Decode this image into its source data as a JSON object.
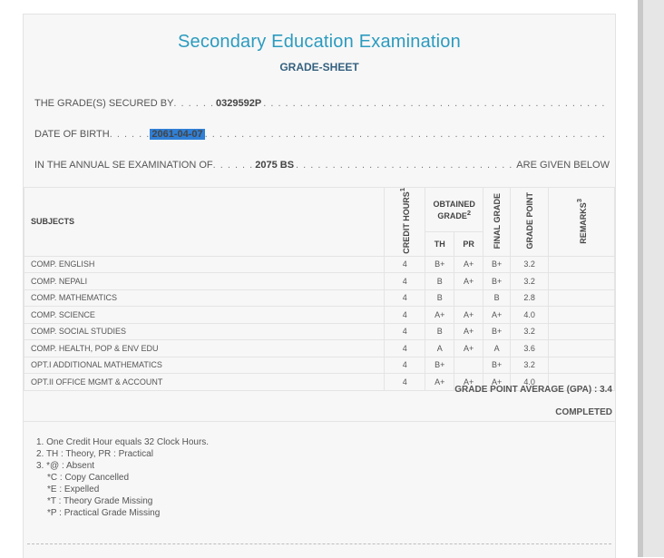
{
  "title": "Secondary Education Examination",
  "subtitle": "GRADE-SHEET",
  "secured_by": {
    "label": "THE GRADE(S) SECURED BY",
    "value": "0329592P"
  },
  "dob": {
    "label": "DATE OF BIRTH",
    "value": "2061-04-07"
  },
  "exam": {
    "label": "IN THE ANNUAL SE EXAMINATION OF",
    "value": "2075 BS",
    "suffix": "ARE GIVEN BELOW"
  },
  "table": {
    "headers": {
      "subjects": "SUBJECTS",
      "credit_hours": "CREDIT HOURS",
      "credit_sup": "1",
      "obtained_grade": "OBTAINED GRADE",
      "obtained_sup": "2",
      "th": "TH",
      "pr": "PR",
      "final_grade": "FINAL GRADE",
      "grade_point": "GRADE POINT",
      "remarks": "REMARKS",
      "remarks_sup": "3"
    },
    "rows": [
      {
        "subject": "COMP. ENGLISH",
        "credit": "4",
        "th": "B+",
        "pr": "A+",
        "final": "B+",
        "gp": "3.2",
        "remarks": ""
      },
      {
        "subject": "COMP. NEPALI",
        "credit": "4",
        "th": "B",
        "pr": "A+",
        "final": "B+",
        "gp": "3.2",
        "remarks": ""
      },
      {
        "subject": "COMP. MATHEMATICS",
        "credit": "4",
        "th": "B",
        "pr": "",
        "final": "B",
        "gp": "2.8",
        "remarks": ""
      },
      {
        "subject": "COMP. SCIENCE",
        "credit": "4",
        "th": "A+",
        "pr": "A+",
        "final": "A+",
        "gp": "4.0",
        "remarks": ""
      },
      {
        "subject": "COMP. SOCIAL STUDIES",
        "credit": "4",
        "th": "B",
        "pr": "A+",
        "final": "B+",
        "gp": "3.2",
        "remarks": ""
      },
      {
        "subject": "COMP. HEALTH, POP & ENV EDU",
        "credit": "4",
        "th": "A",
        "pr": "A+",
        "final": "A",
        "gp": "3.6",
        "remarks": ""
      },
      {
        "subject": "OPT.I ADDITIONAL MATHEMATICS",
        "credit": "4",
        "th": "B+",
        "pr": "",
        "final": "B+",
        "gp": "3.2",
        "remarks": ""
      },
      {
        "subject": "OPT.II OFFICE MGMT & ACCOUNT",
        "credit": "4",
        "th": "A+",
        "pr": "A+",
        "final": "A+",
        "gp": "4.0",
        "remarks": ""
      }
    ]
  },
  "gpa": "GRADE POINT AVERAGE (GPA) : 3.4",
  "status": "COMPLETED",
  "notes": [
    "1. One Credit Hour equals 32 Clock Hours.",
    "2. TH : Theory, PR : Practical",
    "3. *@ : Absent",
    "*C : Copy Cancelled",
    "*E : Expelled",
    "*T : Theory Grade Missing",
    "*P : Practical Grade Missing"
  ]
}
